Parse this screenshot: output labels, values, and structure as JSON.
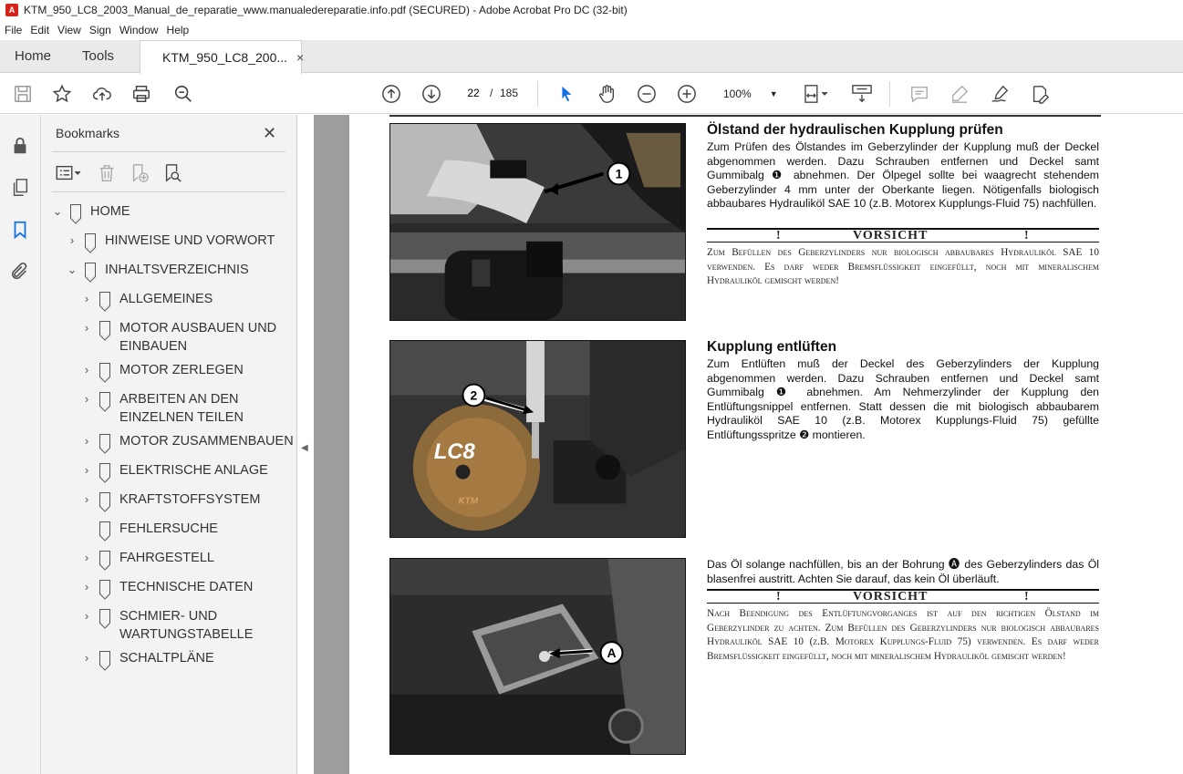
{
  "window": {
    "title": "KTM_950_LC8_2003_Manual_de_reparatie_www.manualedereparatie.info.pdf (SECURED) - Adobe Acrobat Pro DC (32-bit)"
  },
  "menu": [
    "File",
    "Edit",
    "View",
    "Sign",
    "Window",
    "Help"
  ],
  "tabs": {
    "home": "Home",
    "tools": "Tools",
    "doc": "KTM_950_LC8_200...",
    "close": "×"
  },
  "toolbar": {
    "page_current": "22",
    "page_sep": "/",
    "page_total": "185",
    "zoom": "100%"
  },
  "bookmarks": {
    "title": "Bookmarks",
    "close": "✕",
    "items": [
      {
        "label": "HOME",
        "arrow": "⌄",
        "level": 0
      },
      {
        "label": "HINWEISE UND VORWORT",
        "arrow": "›",
        "level": 1
      },
      {
        "label": "INHALTSVERZEICHNIS",
        "arrow": "⌄",
        "level": 1
      },
      {
        "label": "ALLGEMEINES",
        "arrow": "›",
        "level": 2
      },
      {
        "label": "MOTOR AUSBAUEN UND\nEINBAUEN",
        "arrow": "›",
        "level": 2
      },
      {
        "label": "MOTOR ZERLEGEN",
        "arrow": "›",
        "level": 2
      },
      {
        "label": "ARBEITEN AN DEN\nEINZELNEN TEILEN",
        "arrow": "›",
        "level": 2
      },
      {
        "label": "MOTOR ZUSAMMENBAUEN",
        "arrow": "›",
        "level": 2
      },
      {
        "label": "ELEKTRISCHE ANLAGE",
        "arrow": "›",
        "level": 2
      },
      {
        "label": "KRAFTSTOFFSYSTEM",
        "arrow": "›",
        "level": 2
      },
      {
        "label": "FEHLERSUCHE",
        "arrow": "",
        "level": 2
      },
      {
        "label": "FAHRGESTELL",
        "arrow": "›",
        "level": 2
      },
      {
        "label": "TECHNISCHE DATEN",
        "arrow": "›",
        "level": 2
      },
      {
        "label": "SCHMIER- UND\nWARTUNGSTABELLE",
        "arrow": "›",
        "level": 2
      },
      {
        "label": "SCHALTPLÄNE",
        "arrow": "›",
        "level": 2
      }
    ]
  },
  "document": {
    "section1": {
      "heading": "Ölstand der hydraulischen Kupplung prüfen",
      "text": "Zum Prüfen des Ölstandes im Geberzylinder der Kupplung muß der Deckel abgenommen werden. Dazu Schrauben entfernen und Deckel samt Gummibalg ❶ abnehmen. Der Ölpegel sollte bei waagrecht stehendem Geberzylinder 4 mm unter der Oberkante liegen. Nötigenfalls biologisch abbaubares Hydrauliköl SAE 10 (z.B. Motorex Kupplungs-Fluid 75) nachfüllen.",
      "warn_excl": "!",
      "warn_word": "VORSICHT",
      "warn_text": "Zum Befüllen des Geberzylinders nur biologisch abbaubares Hydrauliköl SAE 10 verwenden. Es darf weder Bremsflüssigkeit eingefüllt, noch mit mineralischem Hydrauliköl gemischt werden!",
      "callout": "1"
    },
    "section2": {
      "heading": "Kupplung entlüften",
      "text": "Zum Entlüften muß der Deckel des Geberzylinders der Kupplung abgenommen werden. Dazu Schrauben entfernen und Deckel samt Gummibalg ❶ abnehmen. Am Nehmerzylinder der Kupplung den Entlüftungsnippel entfernen. Statt dessen die mit biologisch abbaubarem Hydrauliköl SAE 10 (z.B. Motorex Kupplungs-Fluid 75) gefüllte Entlüftungsspritze ❷ montieren.",
      "callout": "2",
      "engine_label": "LC8",
      "engine_brand": "KTM"
    },
    "section3": {
      "text": "Das Öl solange nachfüllen, bis an der Bohrung 🅐 des Geberzylinders das Öl blasenfrei austritt. Achten Sie darauf, das kein Öl überläuft.",
      "warn_excl": "!",
      "warn_word": "VORSICHT",
      "warn_text": "Nach Beendigung des Entlüftungvorganges ist auf den richtigen Ölstand im Geberzylinder zu achten. Zum Befüllen des Geberzylinders nur biologisch abbaubares Hydrauliköl SAE 10 (z.B. Motorex Kupplungs-Fluid 75) verwenden. Es darf weder Bremsflüssigkeit eingefüllt, noch mit mineralischem Hydrauliköl gemischt werden!",
      "callout": "A"
    }
  },
  "colors": {
    "acrobat_red": "#d4241c",
    "select_blue": "#1473e6",
    "panel_bg": "#f3f3f3",
    "doc_bg": "#9d9d9d"
  }
}
